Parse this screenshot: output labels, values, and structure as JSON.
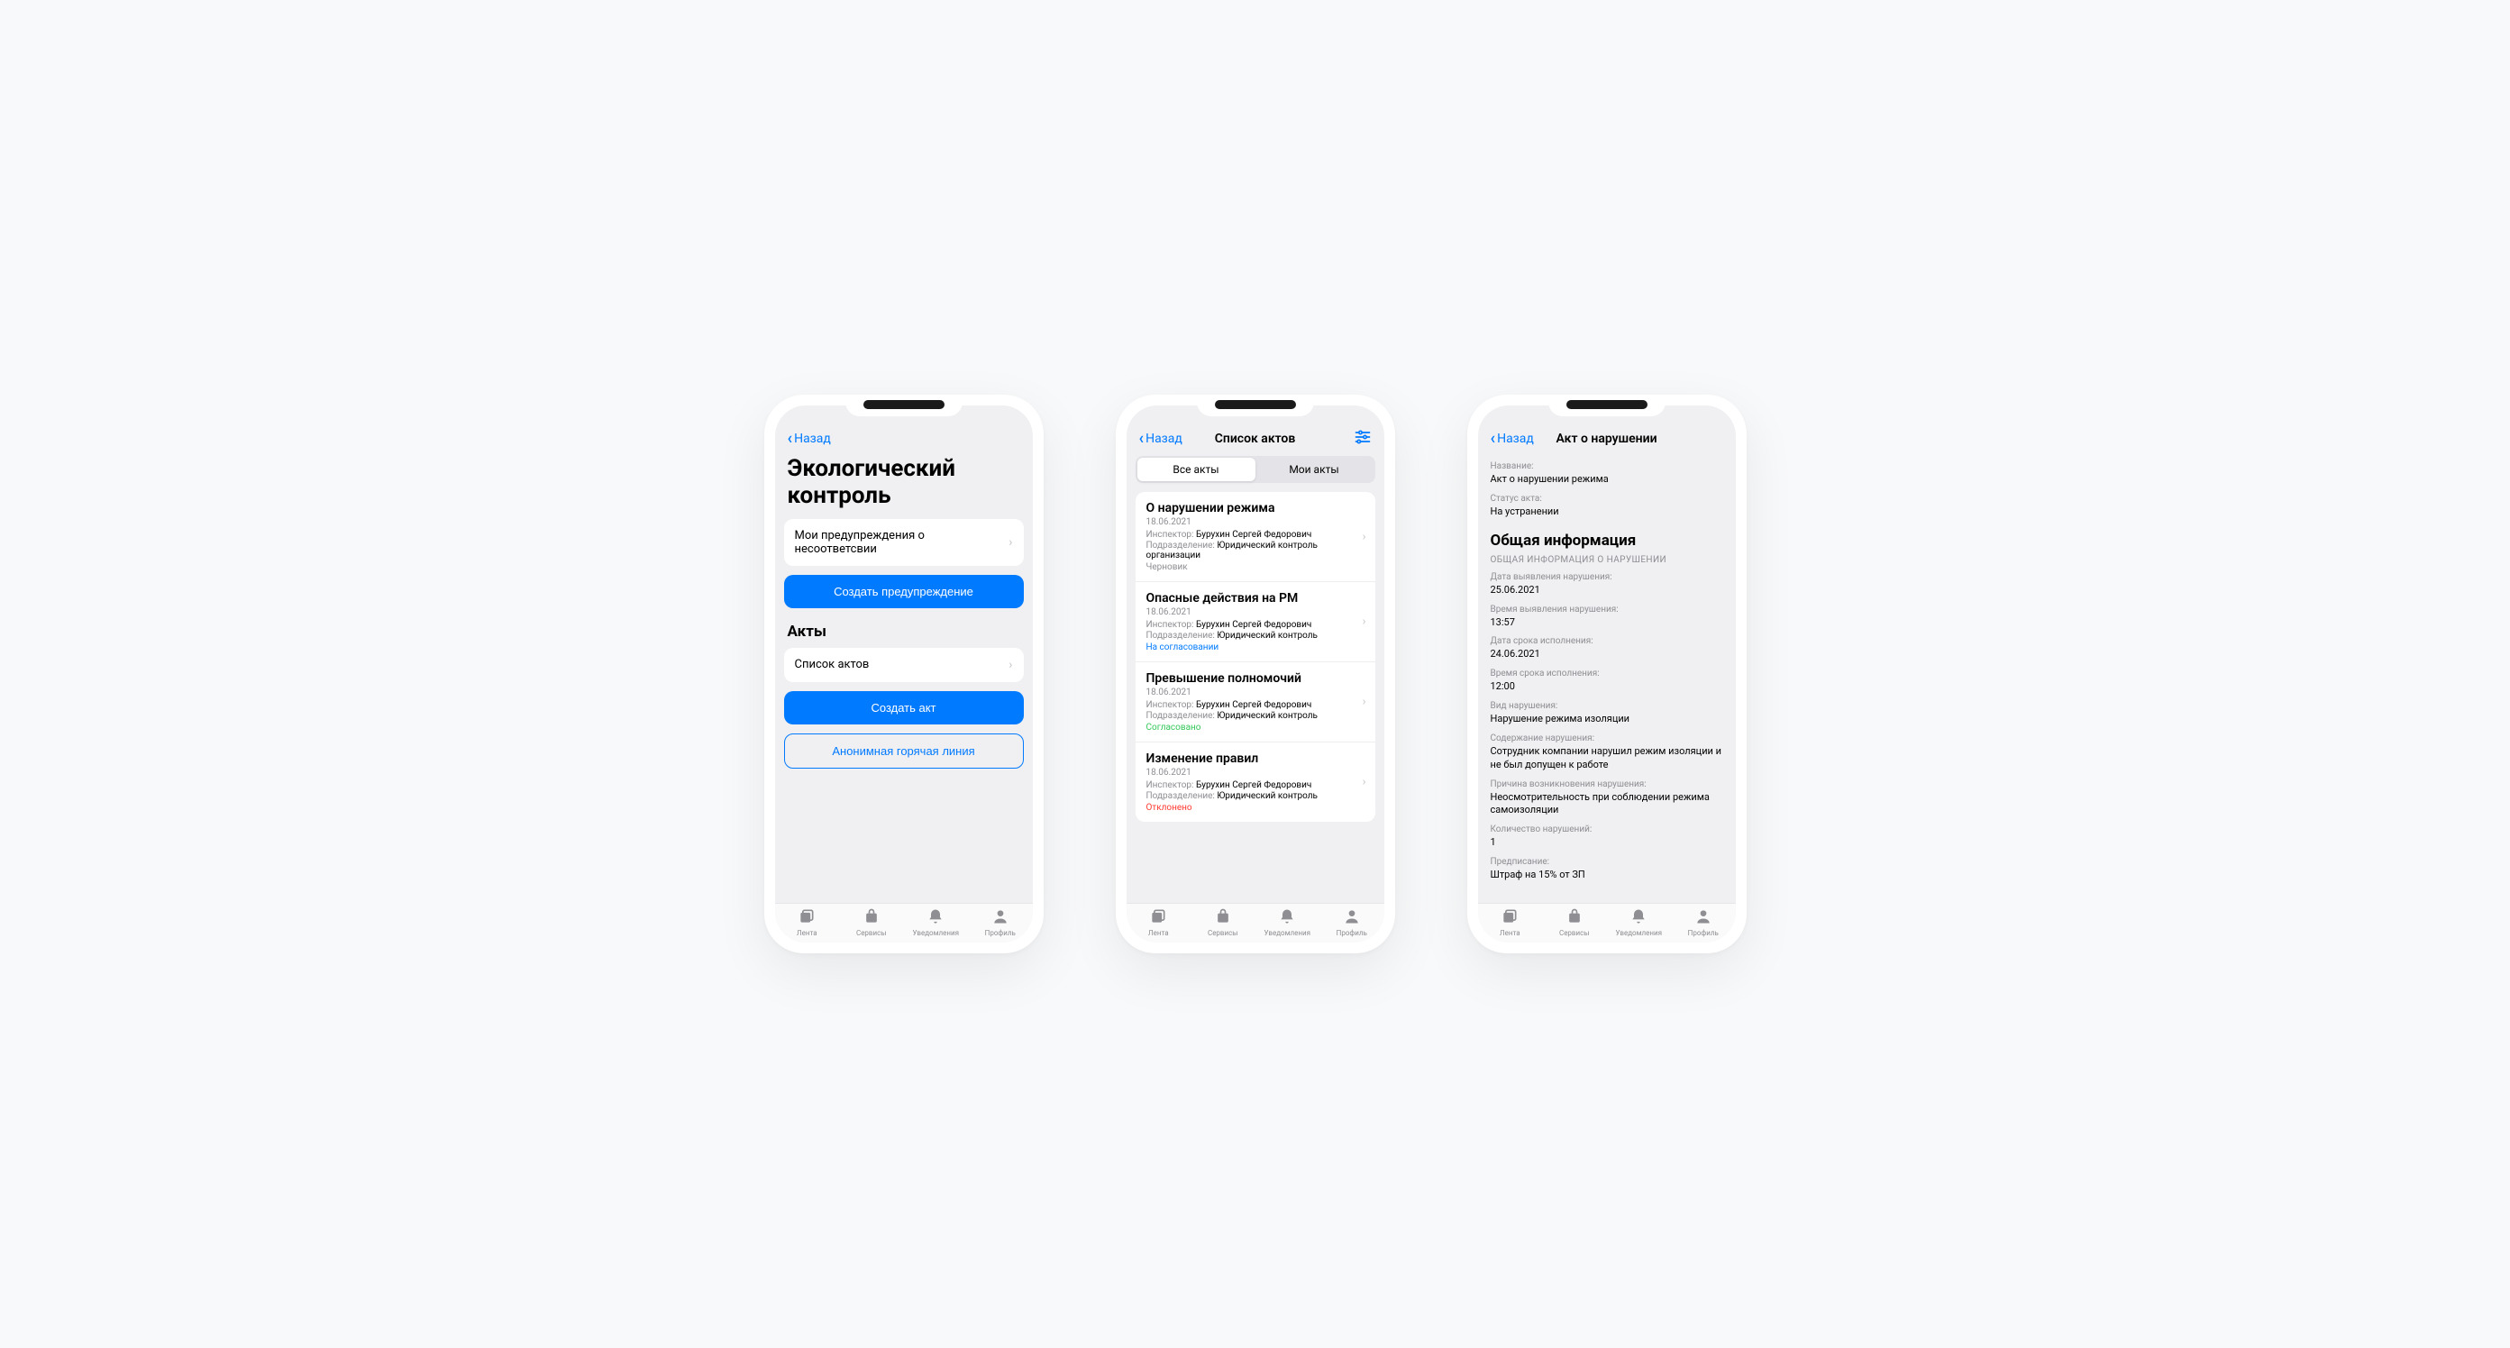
{
  "back_label": "Назад",
  "tabs": [
    "Лента",
    "Сервисы",
    "Уведомления",
    "Профиль"
  ],
  "screen1": {
    "title": "Экологический контроль",
    "warnings_label": "Мои предупреждения о несоответсвии",
    "create_warning": "Создать предупреждение",
    "acts_heading": "Акты",
    "acts_list_label": "Список актов",
    "create_act": "Создать акт",
    "hotline": "Анонимная горячая линия"
  },
  "screen2": {
    "title": "Список актов",
    "seg_all": "Все акты",
    "seg_mine": "Мои акты",
    "labels": {
      "inspector": "Инспектор:",
      "dept": "Подразделение:"
    },
    "items": [
      {
        "title": "О нарушении режима",
        "date": "18.06.2021",
        "inspector": "Бурухин Сергей Федорович",
        "dept": "Юридический контроль организации",
        "status": "Черновик",
        "status_cls": "st-draft"
      },
      {
        "title": "Опасные действия на РМ",
        "date": "18.06.2021",
        "inspector": "Бурухин Сергей Федорович",
        "dept": "Юридический контроль",
        "status": "На согласовании",
        "status_cls": "st-review"
      },
      {
        "title": "Превышение полномочий",
        "date": "18.06.2021",
        "inspector": "Бурухин Сергей Федорович",
        "dept": "Юридический контроль",
        "status": "Согласовано",
        "status_cls": "st-ok"
      },
      {
        "title": "Изменение правил",
        "date": "18.06.2021",
        "inspector": "Бурухин Сергей Федорович",
        "dept": "Юридический контроль",
        "status": "Отклонено",
        "status_cls": "st-rej"
      }
    ]
  },
  "screen3": {
    "title": "Акт о нарушении",
    "name_label": "Название:",
    "name_value": "Акт о нарушении режима",
    "status_label": "Статус акта:",
    "status_value": "На устранении",
    "section_heading": "Общая информация",
    "section_caps": "ОБЩАЯ ИНФОРМАЦИЯ О НАРУШЕНИИ",
    "fields": [
      {
        "label": "Дата выявления нарушения:",
        "value": "25.06.2021"
      },
      {
        "label": "Время выявления нарушения:",
        "value": "13:57"
      },
      {
        "label": "Дата срока исполнения:",
        "value": "24.06.2021"
      },
      {
        "label": "Время срока исполнения:",
        "value": "12:00"
      },
      {
        "label": "Вид нарушения:",
        "value": "Нарушение режима изоляции"
      },
      {
        "label": "Содержание нарушения:",
        "value": "Сотрудник компании нарушил режим изоляции и не был допущен к работе"
      },
      {
        "label": "Причина возникновения нарушения:",
        "value": "Неосмотрительность при соблюдении режима самоизоляции"
      },
      {
        "label": "Количество нарушений:",
        "value": "1"
      },
      {
        "label": "Предписание:",
        "value": "Штраф на 15% от ЗП"
      }
    ]
  }
}
